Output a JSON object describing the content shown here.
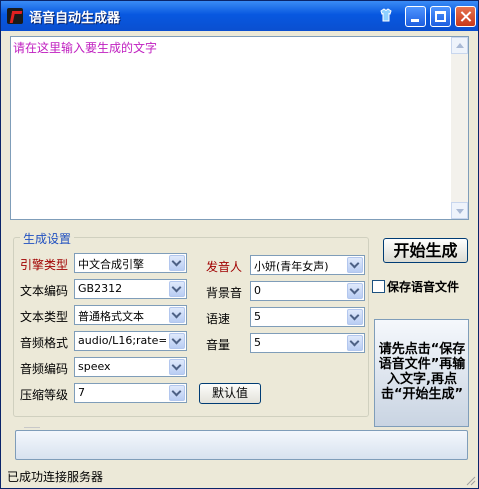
{
  "window": {
    "title": "语音自动生成器"
  },
  "text_input": {
    "placeholder": "请在这里输入要生成的文字"
  },
  "settings": {
    "group_title": "生成设置",
    "engine_type": {
      "label": "引擎类型",
      "value": "中文合成引擎"
    },
    "text_encoding": {
      "label": "文本编码",
      "value": "GB2312"
    },
    "text_type": {
      "label": "文本类型",
      "value": "普通格式文本"
    },
    "audio_format": {
      "label": "音频格式",
      "value": "audio/L16;rate="
    },
    "audio_encoding": {
      "label": "音频编码",
      "value": "speex"
    },
    "compression_level": {
      "label": "压缩等级",
      "value": "7"
    },
    "speaker": {
      "label": "发音人",
      "value": "小妍(青年女声)"
    },
    "background_sound": {
      "label": "背景音",
      "value": "0"
    },
    "speed": {
      "label": "语速",
      "value": "5"
    },
    "volume": {
      "label": "音量",
      "value": "5"
    },
    "default_button": "默认值"
  },
  "actions": {
    "start_button": "开始生成",
    "save_audio_label": "保存语音文件",
    "save_audio_checked": false,
    "instruction": "请先点击“保存语音文件”再输入文字,再点击“开始生成”"
  },
  "status": {
    "text": "已成功连接服务器"
  },
  "colors": {
    "title_bar": "#0858e0",
    "placeholder": "#c020c0",
    "label_red": "#a00000",
    "group_title": "#2050c0"
  }
}
